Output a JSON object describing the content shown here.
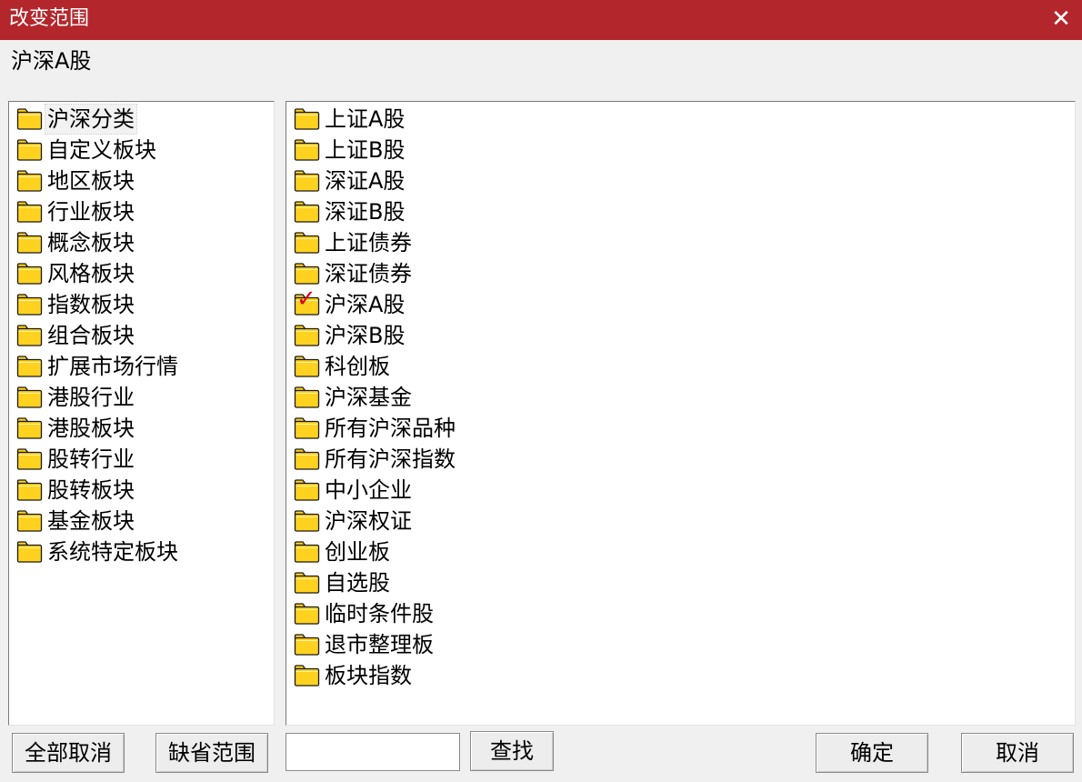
{
  "window": {
    "title": "改变范围",
    "close_glyph": "✕"
  },
  "current_scope": "沪深A股",
  "left_list": {
    "items": [
      {
        "label": "沪深分类",
        "icon": "folder-icon",
        "selected": true
      },
      {
        "label": "自定义板块",
        "icon": "folder-icon"
      },
      {
        "label": "地区板块",
        "icon": "folder-icon"
      },
      {
        "label": "行业板块",
        "icon": "folder-icon"
      },
      {
        "label": "概念板块",
        "icon": "folder-icon"
      },
      {
        "label": "风格板块",
        "icon": "folder-icon"
      },
      {
        "label": "指数板块",
        "icon": "folder-icon"
      },
      {
        "label": "组合板块",
        "icon": "folder-icon"
      },
      {
        "label": "扩展市场行情",
        "icon": "folder-icon"
      },
      {
        "label": "港股行业",
        "icon": "folder-icon"
      },
      {
        "label": "港股板块",
        "icon": "folder-icon"
      },
      {
        "label": "股转行业",
        "icon": "folder-icon"
      },
      {
        "label": "股转板块",
        "icon": "folder-icon"
      },
      {
        "label": "基金板块",
        "icon": "folder-icon"
      },
      {
        "label": "系统特定板块",
        "icon": "folder-icon"
      }
    ]
  },
  "right_list": {
    "items": [
      {
        "label": "上证A股",
        "icon": "folder-icon"
      },
      {
        "label": "上证B股",
        "icon": "folder-icon"
      },
      {
        "label": "深证A股",
        "icon": "folder-icon"
      },
      {
        "label": "深证B股",
        "icon": "folder-icon"
      },
      {
        "label": "上证债券",
        "icon": "folder-icon"
      },
      {
        "label": "深证债券",
        "icon": "folder-icon"
      },
      {
        "label": "沪深A股",
        "icon": "folder-check-icon",
        "checked": true
      },
      {
        "label": "沪深B股",
        "icon": "folder-icon"
      },
      {
        "label": "科创板",
        "icon": "folder-icon"
      },
      {
        "label": "沪深基金",
        "icon": "folder-icon"
      },
      {
        "label": "所有沪深品种",
        "icon": "folder-icon"
      },
      {
        "label": "所有沪深指数",
        "icon": "folder-icon"
      },
      {
        "label": "中小企业",
        "icon": "folder-icon"
      },
      {
        "label": "沪深权证",
        "icon": "folder-icon"
      },
      {
        "label": "创业板",
        "icon": "folder-icon"
      },
      {
        "label": "自选股",
        "icon": "folder-icon"
      },
      {
        "label": "临时条件股",
        "icon": "folder-icon"
      },
      {
        "label": "退市整理板",
        "icon": "folder-icon"
      },
      {
        "label": "板块指数",
        "icon": "folder-icon"
      }
    ]
  },
  "buttons": {
    "clear_all": "全部取消",
    "default_scope": "缺省范围",
    "find": "查找",
    "ok": "确定",
    "cancel": "取消"
  },
  "search": {
    "value": ""
  },
  "colors": {
    "titlebar": "#b3272c",
    "folder_fill": "#ffd21f",
    "folder_outline": "#1a1a1a",
    "check_mark": "#e0001a"
  }
}
